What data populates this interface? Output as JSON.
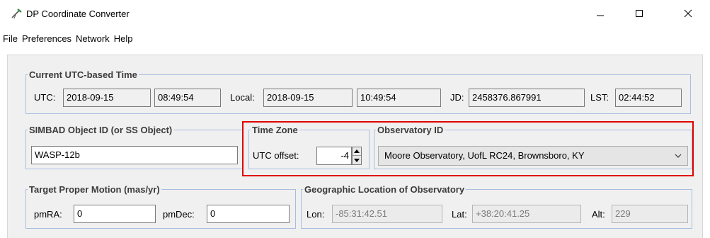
{
  "window": {
    "title": "DP Coordinate Converter",
    "icons": {
      "app": "telescope-icon",
      "minimize": "minimize-icon",
      "maximize": "maximize-icon",
      "close": "close-icon"
    }
  },
  "menu": {
    "items": [
      "File",
      "Preferences",
      "Network",
      "Help"
    ]
  },
  "utc_group": {
    "legend": "Current UTC-based Time",
    "utc_label": "UTC:",
    "utc_date": "2018-09-15",
    "utc_time": "08:49:54",
    "local_label": "Local:",
    "local_date": "2018-09-15",
    "local_time": "10:49:54",
    "jd_label": "JD:",
    "jd_value": "2458376.867991",
    "lst_label": "LST:",
    "lst_value": "02:44:52"
  },
  "simbad_group": {
    "legend": "SIMBAD Object ID (or SS Object)",
    "value": "WASP-12b"
  },
  "timezone_group": {
    "legend": "Time Zone",
    "utc_offset_label": "UTC offset:",
    "utc_offset_value": "-4"
  },
  "observatory_group": {
    "legend": "Observatory ID",
    "selected": "Moore Observatory, UofL RC24, Brownsboro, KY"
  },
  "proper_motion_group": {
    "legend": "Target Proper Motion (mas/yr)",
    "pmra_label": "pmRA:",
    "pmra_value": "0",
    "pmdec_label": "pmDec:",
    "pmdec_value": "0"
  },
  "geo_group": {
    "legend": "Geographic Location of Observatory",
    "lon_label": "Lon:",
    "lon_value": "-85:31:42.51",
    "lat_label": "Lat:",
    "lat_value": "+38:20:41.25",
    "alt_label": "Alt:",
    "alt_value": "229"
  },
  "colors": {
    "highlight": "#e00000",
    "group_border": "#a9bde0"
  }
}
